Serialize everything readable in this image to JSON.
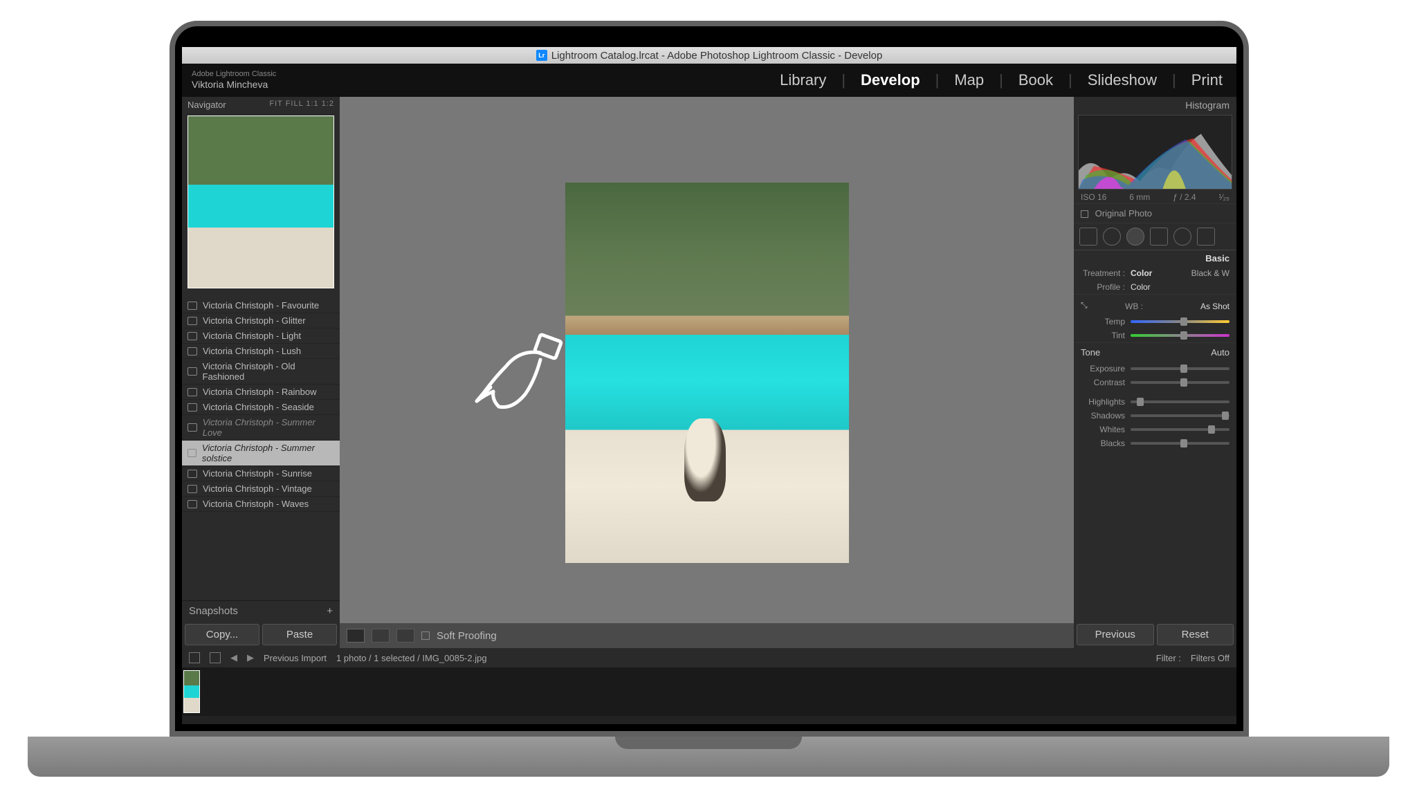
{
  "titlebar": {
    "text": "Lightroom Catalog.lrcat - Adobe Photoshop Lightroom Classic - Develop",
    "icon_label": "Lr"
  },
  "identity": {
    "app": "Adobe Lightroom Classic",
    "user": "Viktoria Mincheva"
  },
  "modules": {
    "library": "Library",
    "develop": "Develop",
    "map": "Map",
    "book": "Book",
    "slideshow": "Slideshow",
    "print": "Print"
  },
  "navigator": {
    "title": "Navigator",
    "zoom": "FIT  FILL  1:1  1:2"
  },
  "presets": {
    "items": [
      {
        "label": "Victoria Christoph - Favourite"
      },
      {
        "label": "Victoria Christoph - Glitter"
      },
      {
        "label": "Victoria Christoph - Light"
      },
      {
        "label": "Victoria Christoph - Lush"
      },
      {
        "label": "Victoria Christoph - Old Fashioned"
      },
      {
        "label": "Victoria Christoph - Rainbow"
      },
      {
        "label": "Victoria Christoph - Seaside"
      },
      {
        "label": "Victoria Christoph - Summer Love",
        "italic": true
      },
      {
        "label": "Victoria Christoph - Summer solstice",
        "selected": true
      },
      {
        "label": "Victoria Christoph - Sunrise"
      },
      {
        "label": "Victoria Christoph - Vintage"
      },
      {
        "label": "Victoria Christoph - Waves"
      }
    ]
  },
  "snapshots": {
    "title": "Snapshots",
    "plus": "+"
  },
  "left_buttons": {
    "copy": "Copy...",
    "paste": "Paste"
  },
  "center_toolbar": {
    "soft_proofing": "Soft Proofing"
  },
  "right": {
    "histogram": "Histogram",
    "iso": "ISO 16",
    "focal": "6 mm",
    "aperture": "ƒ / 2.4",
    "shutter": "¹⁄₂₅",
    "original": "Original Photo",
    "basic": "Basic",
    "treatment_label": "Treatment :",
    "treatment_color": "Color",
    "treatment_bw": "Black & W",
    "profile_label": "Profile :",
    "profile_value": "Color",
    "wb_label": "WB :",
    "wb_value": "As Shot",
    "temp": "Temp",
    "tint": "Tint",
    "tone": "Tone",
    "auto": "Auto",
    "exposure": "Exposure",
    "contrast": "Contrast",
    "highlights": "Highlights",
    "shadows": "Shadows",
    "whites": "Whites",
    "blacks": "Blacks"
  },
  "right_buttons": {
    "previous": "Previous",
    "reset": "Reset"
  },
  "filmstrip": {
    "source": "Previous Import",
    "count": "1 photo / 1 selected / IMG_0085-2.jpg",
    "filter_label": "Filter :",
    "filter_value": "Filters Off"
  }
}
